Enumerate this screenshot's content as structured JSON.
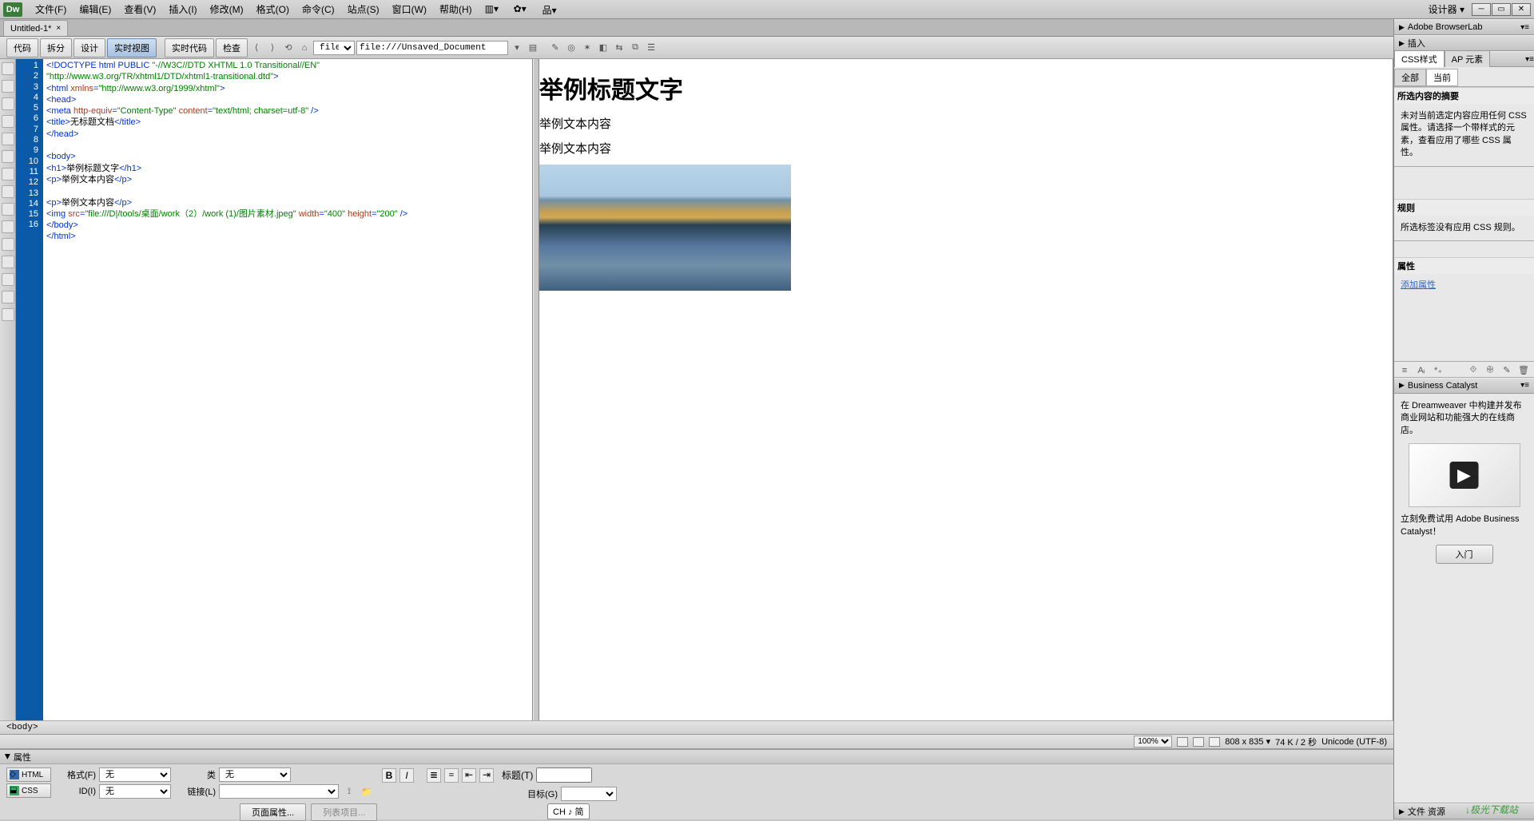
{
  "app": {
    "logo": "Dw"
  },
  "menu": {
    "items": [
      "文件(F)",
      "编辑(E)",
      "查看(V)",
      "插入(I)",
      "修改(M)",
      "格式(O)",
      "命令(C)",
      "站点(S)",
      "窗口(W)",
      "帮助(H)"
    ],
    "workspace": "设计器"
  },
  "tab": {
    "label": "Untitled-1*",
    "close": "×"
  },
  "viewbar": {
    "buttons": [
      "代码",
      "拆分",
      "设计",
      "实时视图"
    ],
    "extra": [
      "实时代码",
      "检查"
    ],
    "url_scheme": "file:",
    "url_value": "file:///Unsaved_Document"
  },
  "gutter_lines": 16,
  "code": {
    "l1a": "<!DOCTYPE html PUBLIC ",
    "l1b": "\"-//W3C//DTD XHTML 1.0 Transitional//EN\"",
    "l2": "\"http://www.w3.org/TR/xhtml1/DTD/xhtml1-transitional.dtd\"",
    "l2b": ">",
    "l3a": "<html ",
    "l3b": "xmlns",
    "l3c": "=",
    "l3d": "\"http://www.w3.org/1999/xhtml\"",
    "l3e": ">",
    "l4": "<head>",
    "l5a": "<meta ",
    "l5b": "http-equiv",
    "l5c": "=",
    "l5d": "\"Content-Type\"",
    "l5e": " content",
    "l5f": "=",
    "l5g": "\"text/html; charset=utf-8\"",
    "l5h": " />",
    "l6a": "<title>",
    "l6b": "无标题文档",
    "l6c": "</title>",
    "l7": "</head>",
    "l8": "",
    "l9": "<body>",
    "l10a": "<h1>",
    "l10b": "举例标题文字",
    "l10c": "</h1>",
    "l11a": "<p>",
    "l11b": "举例文本内容",
    "l11c": "</p>",
    "l12": "",
    "l13a": "<p>",
    "l13b": "举例文本内容",
    "l13c": "</p>",
    "l14a": "<img ",
    "l14b": "src",
    "l14c": "=",
    "l14d": "\"file:///D|/tools/桌面/work（2）/work (1)/图片素材.jpeg\"",
    "l14e": " width",
    "l14f": "=",
    "l14g": "\"400\"",
    "l14h": " height",
    "l14i": "=",
    "l14j": "\"200\"",
    "l14k": " />",
    "l15": "</body>",
    "l16": "</html>"
  },
  "preview": {
    "h1": "举例标题文字",
    "p1": "举例文本内容",
    "p2": "举例文本内容"
  },
  "tagpath": "<body>",
  "status": {
    "zoom": "100%",
    "dims": "808 x 835",
    "size": "74 K / 2 秒",
    "enc": "Unicode (UTF-8)"
  },
  "right": {
    "browserlab": "Adobe BrowserLab",
    "insert": "插入",
    "css_panel": "CSS样式",
    "ap_elements": "AP 元素",
    "all": "全部",
    "current": "当前",
    "summary_title": "所选内容的摘要",
    "summary_text": "未对当前选定内容应用任何 CSS 属性。请选择一个带样式的元素，查看应用了哪些 CSS 属性。",
    "rules_title": "规则",
    "rules_text": "所选标签没有应用 CSS 规则。",
    "props_title": "属性",
    "add_prop": "添加属性",
    "bc_title": "Business Catalyst",
    "bc_text": "在 Dreamweaver 中构建并发布商业网站和功能强大的在线商店。",
    "bc_try": "立刻免费试用 Adobe Business Catalyst！",
    "bc_btn": "入门"
  },
  "props": {
    "title": "属性",
    "html_btn": "HTML",
    "css_btn": "CSS",
    "format": "格式(F)",
    "id": "ID(I)",
    "none": "无",
    "class": "类",
    "link": "链接(L)",
    "title_lbl": "标题(T)",
    "target": "目标(G)",
    "page_props": "页面属性...",
    "list_items": "列表项目..."
  },
  "ime": "CH ♪ 简",
  "watermark": "↓极光下载站"
}
